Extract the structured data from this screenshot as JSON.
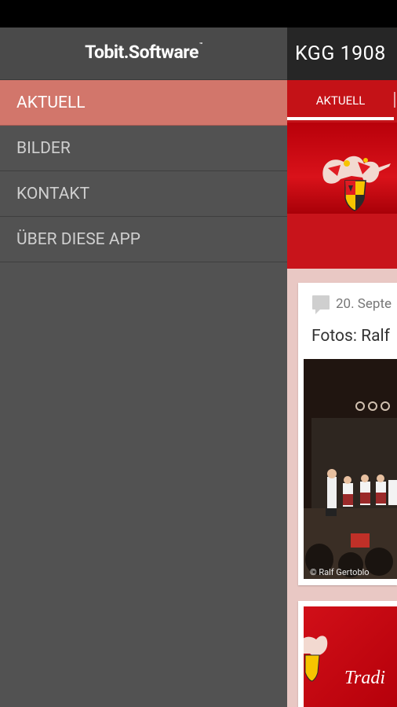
{
  "app": {
    "title": "KGG 1908",
    "tabs": [
      {
        "label": "AKTUELL",
        "selected": true
      }
    ]
  },
  "drawer": {
    "brand": "Tobit.Software",
    "brand_tm": "™",
    "menu": [
      {
        "label": "AKTUELL",
        "active": true
      },
      {
        "label": "BILDER",
        "active": false
      },
      {
        "label": "KONTAKT",
        "active": false
      },
      {
        "label": "ÜBER DIESE APP",
        "active": false
      }
    ]
  },
  "feed": {
    "post1": {
      "date": "20. Septe",
      "title": "Fotos: Ralf",
      "photo_caption": "© Ralf Gertoblo"
    },
    "post2": {
      "text": "Tradi"
    }
  },
  "colors": {
    "accent_red": "#c41217",
    "drawer_bg": "#525252",
    "drawer_active": "#d2766b",
    "appbar_bg": "#262626"
  },
  "icons": [
    "comment-icon",
    "crest-logo"
  ]
}
